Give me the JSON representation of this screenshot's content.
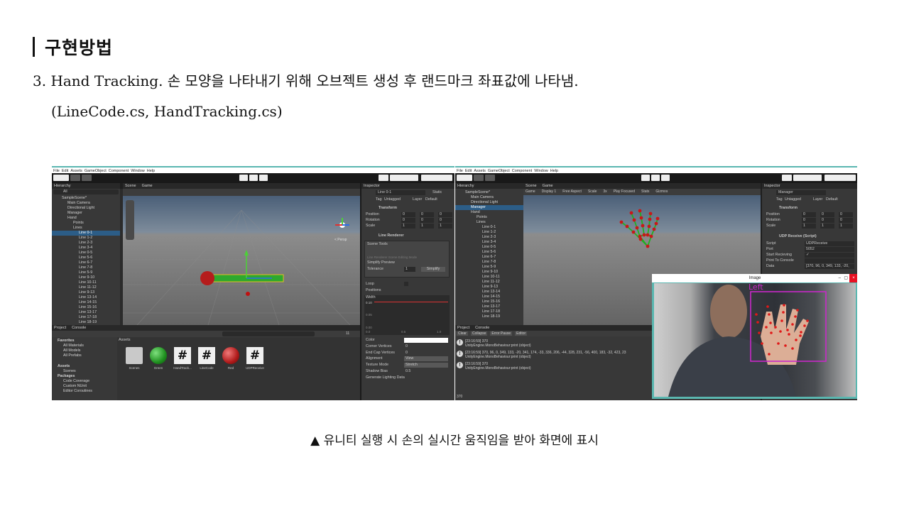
{
  "heading": "구현방법",
  "line1": "3. Hand Tracking. 손 모양을 나타내기 위해 오브젝트 생성 후 랜드마크 좌표값에 나타냄.",
  "line2": "(LineCode.cs, HandTracking.cs)",
  "caption": "▲ 유니티 실행 시 손의 실시간 움직임을 받아 화면에 표시",
  "colors": {
    "accent": "#2c5d87",
    "teal": "#5ab7b0",
    "landmark": "#e01818",
    "bbox": "#c828c8"
  },
  "left": {
    "menu": [
      "File",
      "Edit",
      "Assets",
      "GameObject",
      "Component",
      "Window",
      "Help"
    ],
    "hierarchy_tab": "Hierarchy",
    "scene_tab": "Scene",
    "game_tab": "Game",
    "inspector_tab": "Inspector",
    "search_placeholder": "All",
    "persp": "< Persp",
    "tree": [
      "SampleScene*",
      "Main Camera",
      "Directional Light",
      "Manager",
      "Hand",
      "Points",
      "Lines",
      "Line 0-1",
      "Line 1-2",
      "Line 2-3",
      "Line 3-4",
      "Line 0-5",
      "Line 5-6",
      "Line 6-7",
      "Line 7-8",
      "Line 5-9",
      "Line 9-10",
      "Line 10-11",
      "Line 11-12",
      "Line 9-13",
      "Line 13-14",
      "Line 14-15",
      "Line 15-16",
      "Line 13-17",
      "Line 17-18",
      "Line 18-19"
    ],
    "inspector": {
      "object_name": "Line 0-1",
      "static": "Static",
      "tag_label": "Tag",
      "tag": "Untagged",
      "layer_label": "Layer",
      "layer": "Default",
      "transform": "Transform",
      "rows": [
        {
          "label": "Position",
          "x": "0",
          "y": "0",
          "z": "0"
        },
        {
          "label": "Rotation",
          "x": "0",
          "y": "0",
          "z": "0"
        },
        {
          "label": "Scale",
          "x": "1",
          "y": "1",
          "z": "1"
        }
      ],
      "line_renderer": "Line Renderer",
      "scene_tools": "Scene Tools",
      "hint": "Line Renderer Scene Editing Mode",
      "simplify_preview": "Simplify Preview",
      "tolerance_label": "Tolerance",
      "tolerance": "1",
      "simplify": "Simplify",
      "loop": "Loop",
      "positions": "Positions",
      "width": "Width",
      "width_val": "0.10",
      "curve_ticks": [
        "0.05",
        "0.00"
      ],
      "curve_x": [
        "0.0",
        "0.5",
        "1.0"
      ],
      "props": [
        {
          "label": "Color",
          "value": ""
        },
        {
          "label": "Corner Vertices",
          "value": "0"
        },
        {
          "label": "End Cap Vertices",
          "value": "0"
        },
        {
          "label": "Alignment",
          "value": "View"
        },
        {
          "label": "Texture Mode",
          "value": "Stretch"
        },
        {
          "label": "Shadow Bias",
          "value": "0.5"
        },
        {
          "label": "Generate Lighting Data",
          "value": ""
        }
      ]
    },
    "project_tab": "Project",
    "console_tab": "Console",
    "favorites": "Favorites",
    "fav_items": [
      "All Materials",
      "All Models",
      "All Prefabs"
    ],
    "assets_header": "Assets",
    "assets_tree": [
      "Assets",
      "Scenes",
      "Packages",
      "Code Coverage",
      "Custom NUnit",
      "Editor Coroutines"
    ],
    "assets": [
      "Scenes",
      "Green",
      "HandTrack...",
      "LineCode",
      "Red",
      "UDPReceive"
    ],
    "counter": "11"
  },
  "right": {
    "menu": [
      "File",
      "Edit",
      "Assets",
      "GameObject",
      "Component",
      "Window",
      "Help"
    ],
    "game_toolbar": [
      "Game",
      "Display 1",
      "Free Aspect",
      "Scale",
      "3x",
      "Play Focused",
      "Stats",
      "Gizmos"
    ],
    "tree": [
      "SampleScene*",
      "Main Camera",
      "Directional Light",
      "Manager",
      "Hand",
      "Points",
      "Lines",
      "Line 0-1",
      "Line 1-2",
      "Line 2-3",
      "Line 3-4",
      "Line 0-5",
      "Line 5-6",
      "Line 6-7",
      "Line 7-8",
      "Line 5-9",
      "Line 9-10",
      "Line 10-11",
      "Line 11-12",
      "Line 9-13",
      "Line 13-14",
      "Line 14-15",
      "Line 15-16",
      "Line 13-17",
      "Line 17-18",
      "Line 18-19"
    ],
    "inspector": {
      "object_name": "Manager",
      "script_title": "UDP Receive (Script)",
      "fields": [
        {
          "label": "Script",
          "value": "UDPReceive"
        },
        {
          "label": "Port",
          "value": "5052"
        },
        {
          "label": "Start Recieving",
          "value": "✓"
        },
        {
          "label": "Print To Console",
          "value": ""
        },
        {
          "label": "Data",
          "value": "[370, 96, 0, 349, 133, -20,"
        }
      ]
    },
    "console_buttons": [
      "Clear",
      "Collapse",
      "Error Pause",
      "Editor"
    ],
    "console": [
      {
        "time": "[23:16:59] 370",
        "src": "UnityEngine.MonoBehaviour:print (object)"
      },
      {
        "time": "[23:16:59] 370, 96, 0, 349, 133, -20, 341, 174, -33, 336, 206, -44, 328, 231, -56, 400, 183, -32, 423, 23",
        "src": "UnityEngine.MonoBehaviour:print (object)"
      },
      {
        "time": "[23:16:59] 370",
        "src": "UnityEngine.MonoBehaviour:print (object)"
      }
    ],
    "status": "370",
    "image_window": {
      "title": "Image",
      "label": "Left"
    }
  }
}
